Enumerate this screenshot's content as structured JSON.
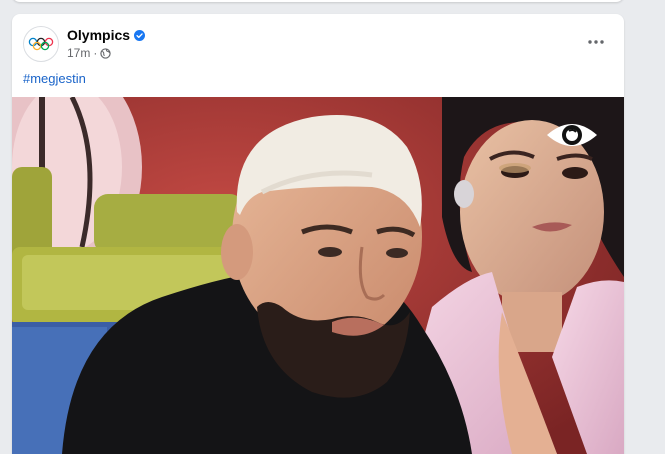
{
  "post": {
    "page_name": "Olympics",
    "verified": true,
    "time": "17m",
    "separator": "·",
    "audience_icon": "globe-icon",
    "more_icon": "more-horizontal-icon",
    "hashtag": "#megjestin"
  },
  "video": {
    "overlay_logo": "eye-logo"
  },
  "colors": {
    "link": "#1a64c9",
    "verified_badge": "#1877f2",
    "meta_text": "#65676b"
  }
}
